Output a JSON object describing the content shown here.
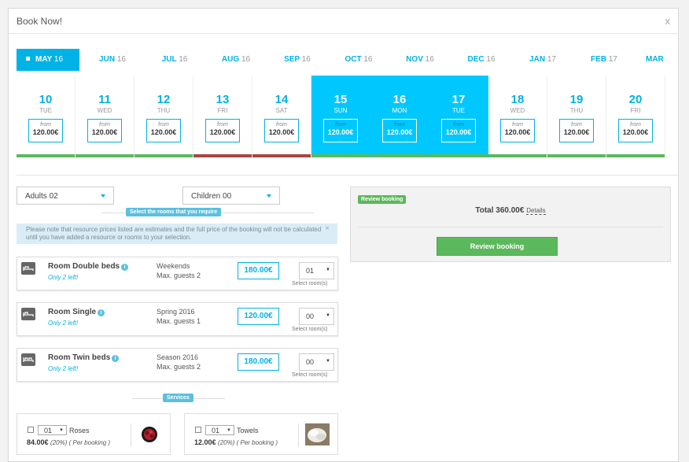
{
  "modal": {
    "title": "Book Now!",
    "close_label": "x"
  },
  "months": [
    {
      "name": "MAY",
      "year": "16",
      "active": true
    },
    {
      "name": "JUN",
      "year": "16"
    },
    {
      "name": "JUL",
      "year": "16"
    },
    {
      "name": "AUG",
      "year": "16"
    },
    {
      "name": "SEP",
      "year": "16"
    },
    {
      "name": "OCT",
      "year": "16"
    },
    {
      "name": "NOV",
      "year": "16"
    },
    {
      "name": "DEC",
      "year": "16"
    },
    {
      "name": "JAN",
      "year": "17"
    },
    {
      "name": "FEB",
      "year": "17"
    },
    {
      "name": "MAR",
      "year": ""
    }
  ],
  "days": [
    {
      "num": "10",
      "dow": "TUE",
      "from": "from",
      "price": "120.00€",
      "selected": false,
      "available": true
    },
    {
      "num": "11",
      "dow": "WED",
      "from": "from",
      "price": "120.00€",
      "selected": false,
      "available": true
    },
    {
      "num": "12",
      "dow": "THU",
      "from": "from",
      "price": "120.00€",
      "selected": false,
      "available": true
    },
    {
      "num": "13",
      "dow": "FRI",
      "from": "from",
      "price": "120.00€",
      "selected": false,
      "available": false
    },
    {
      "num": "14",
      "dow": "SAT",
      "from": "from",
      "price": "120.00€",
      "selected": false,
      "available": false
    },
    {
      "num": "15",
      "dow": "SUN",
      "from": "from",
      "price": "120.00€",
      "selected": true,
      "available": true
    },
    {
      "num": "16",
      "dow": "MON",
      "from": "from",
      "price": "120.00€",
      "selected": true,
      "available": true
    },
    {
      "num": "17",
      "dow": "TUE",
      "from": "from",
      "price": "120.00€",
      "selected": true,
      "available": true
    },
    {
      "num": "18",
      "dow": "WED",
      "from": "from",
      "price": "120.00€",
      "selected": false,
      "available": true
    },
    {
      "num": "19",
      "dow": "THU",
      "from": "from",
      "price": "120.00€",
      "selected": false,
      "available": true
    },
    {
      "num": "20",
      "dow": "FRI",
      "from": "from",
      "price": "120.00€",
      "selected": false,
      "available": true
    }
  ],
  "colors": {
    "accent": "#00b2e6",
    "selected_day": "#00c8ff",
    "available": "#5cb85c",
    "unavailable": "#a94442",
    "info": "#5bc0de"
  },
  "filters": {
    "adults": "Adults 02",
    "children": "Children 00"
  },
  "rooms_heading": "Select the rooms that you require",
  "alert_text": "Please note that resource prices listed are estimates and the full price of the booking will not be calculated until you have added a resource or rooms to your selection.",
  "alert_close": "×",
  "rooms": [
    {
      "name": "Room Double beds",
      "left": "Only 2 left!",
      "season": "Weekends",
      "guests": "Max. guests 2",
      "price": "180.00€",
      "qty": "01",
      "qty_label": "Select room(s)",
      "icon": "double-bed-icon"
    },
    {
      "name": "Room Single",
      "left": "Only 2 left!",
      "season": "Spring 2016",
      "guests": "Max. guests 1",
      "price": "120.00€",
      "qty": "00",
      "qty_label": "Select room(s)",
      "icon": "single-bed-icon"
    },
    {
      "name": "Room Twin beds",
      "left": "Only 2 left!",
      "season": "Season 2016",
      "guests": "Max. guests 2",
      "price": "180.00€",
      "qty": "00",
      "qty_label": "Select room(s)",
      "icon": "twin-bed-icon"
    }
  ],
  "services_heading": "Services",
  "services": [
    {
      "qty": "01",
      "name": "Roses",
      "price": "84.00€",
      "detail": "(20%) ( Per booking )",
      "image": "roses-image"
    },
    {
      "qty": "01",
      "name": "Towels",
      "price": "12.00€",
      "detail": "(20%) ( Per booking )",
      "image": "towels-image"
    }
  ],
  "review": {
    "tag": "Review booking",
    "total_label": "Total 360.00€",
    "details_link": "Details",
    "button": "Review booking"
  }
}
